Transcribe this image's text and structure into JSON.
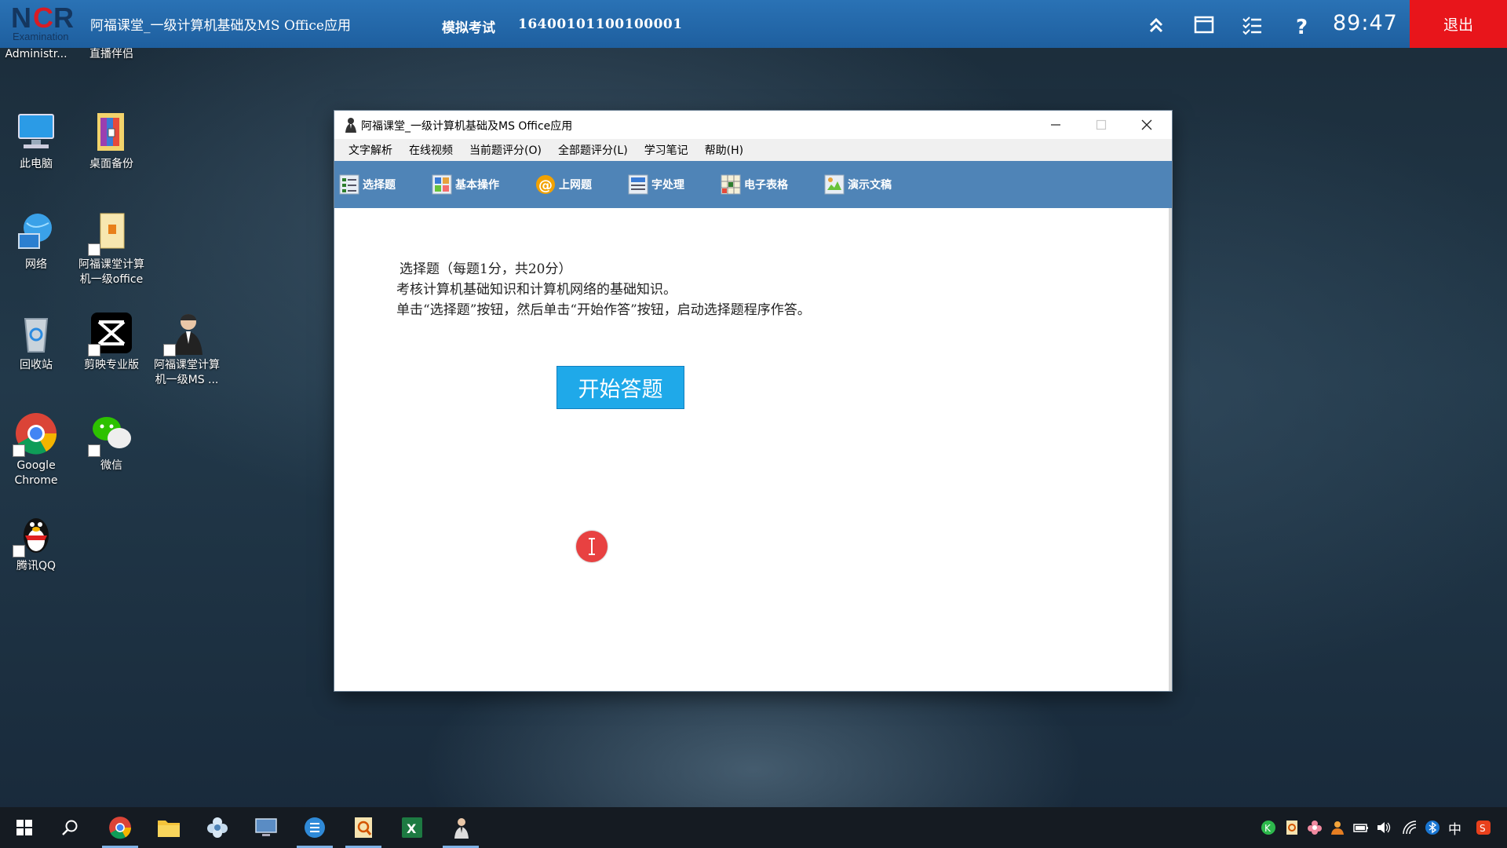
{
  "exam_bar": {
    "logo_text": "NCR",
    "logo_sub": "Examination",
    "title": "阿福课堂_一级计算机基础及MS Office应用",
    "mode": "模拟考试",
    "exam_id": "16400101100100001",
    "timer": "89:47",
    "exit_label": "退出"
  },
  "desktop": {
    "icons": [
      {
        "label": "Administr..."
      },
      {
        "label": "直播伴侣"
      },
      {
        "label": "此电脑"
      },
      {
        "label": "桌面备份"
      },
      {
        "label": "网络"
      },
      {
        "label": "阿福课堂计算机一级office"
      },
      {
        "label": "回收站"
      },
      {
        "label": "剪映专业版"
      },
      {
        "label": "阿福课堂计算机一级MS ..."
      },
      {
        "label": "Google Chrome"
      },
      {
        "label": "微信"
      },
      {
        "label": "腾讯QQ"
      }
    ]
  },
  "window": {
    "title": "阿福课堂_一级计算机基础及MS Office应用",
    "menu": [
      "文字解析",
      "在线视频",
      "当前题评分(O)",
      "全部题评分(L)",
      "学习笔记",
      "帮助(H)"
    ],
    "toolbar": [
      "选择题",
      "基本操作",
      "上网题",
      "字处理",
      "电子表格",
      "演示文稿"
    ],
    "content": {
      "line1": "选择题（每题1分，共20分）",
      "line2": "考核计算机基础知识和计算机网络的基础知识。",
      "line3": "单击“选择题”按钮，然后单击“开始作答”按钮，启动选择题程序作答。",
      "start_button": "开始答题"
    }
  },
  "taskbar": {
    "ime": "中"
  },
  "colors": {
    "exam_bar": "#2a72b5",
    "exit": "#e8151b",
    "toolbar": "#4f84b7",
    "start_button": "#1fa9e9"
  }
}
